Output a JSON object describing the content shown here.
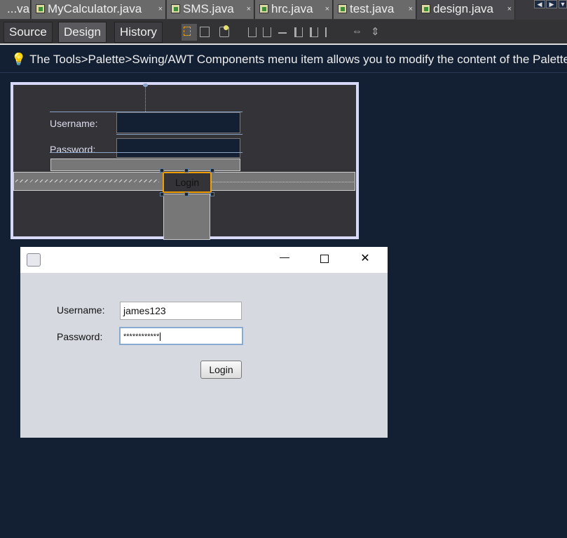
{
  "tabs": [
    {
      "label": "...va",
      "active": false
    },
    {
      "label": "MyCalculator.java",
      "active": false
    },
    {
      "label": "SMS.java",
      "active": false
    },
    {
      "label": "hrc.java",
      "active": false
    },
    {
      "label": "test.java",
      "active": false
    },
    {
      "label": "design.java",
      "active": true
    }
  ],
  "close_glyph": "×",
  "toolbar": {
    "source": "Source",
    "design": "Design",
    "history": "History"
  },
  "hint": "The Tools>Palette>Swing/AWT Components menu item allows you to modify the content of the Palette.",
  "designer": {
    "username_label": "Username:",
    "password_label": "Password:",
    "login_label": "Login"
  },
  "preview": {
    "username_label": "Username:",
    "username_value": "james123",
    "password_label": "Password:",
    "password_value": "************",
    "login_label": "Login",
    "minimize": "—",
    "maximize": "☐",
    "close": "✕"
  }
}
